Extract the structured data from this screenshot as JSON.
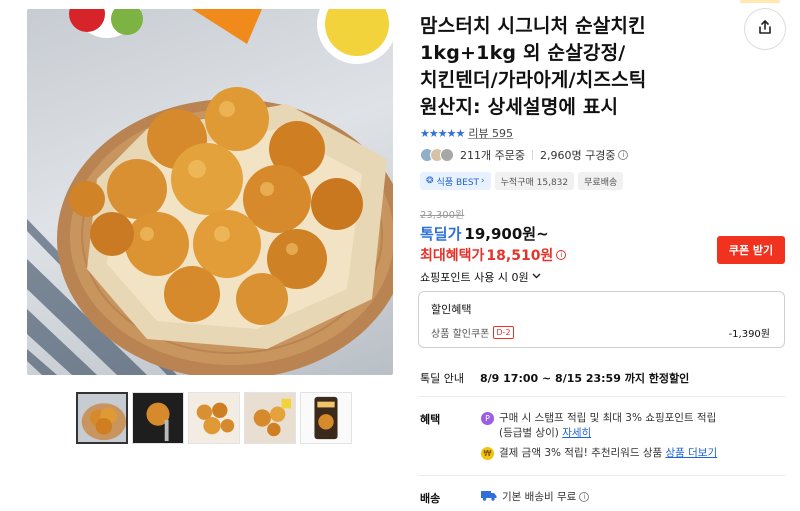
{
  "product": {
    "title": "맘스터치 시그니처 순살치킨\n1kg+1kg 외 순살강정/\n치킨텐더/가라아게/치즈스틱\n원산지: 상세설명에 표시",
    "stars": "★★★★★",
    "review_link": "리뷰 595",
    "orders_text": "211개 주문중",
    "viewers_text": "2,960명 구경중",
    "tags": [
      "식품 BEST",
      "누적구매 15,832",
      "무료배송"
    ]
  },
  "price": {
    "original": "23,300원",
    "deal_label": "톡딜가",
    "deal_price": "19,900원~",
    "max_label": "최대혜택가",
    "max_price": "18,510원",
    "coupon_button": "쿠폰 받기",
    "point_usage": "쇼핑포인트 사용 시 0원"
  },
  "discount": {
    "title": "할인혜택",
    "item_label": "상품 할인쿠폰",
    "item_badge": "D-2",
    "item_amount": "-1,390원"
  },
  "deal_info": {
    "label": "톡딜 안내",
    "text": "8/9 17:00 ~ 8/15 23:59 까지 한정할인"
  },
  "benefits": {
    "label": "혜택",
    "line1": "구매 시 스탬프 적립 및 최대 3% 쇼핑포인트 적립",
    "line1b_prefix": "(등급별 상이)",
    "line1b_link": "자세히",
    "line2_prefix": "결제 금액 3% 적립! 추천리워드 상품",
    "line2_link": "상품 더보기"
  },
  "shipping": {
    "label": "배송",
    "text": "기본 배송비 무료"
  },
  "icons": {
    "share": "share-icon",
    "chevron": "chevron-down-icon",
    "info": "info-icon",
    "truck": "truck-icon"
  },
  "colors": {
    "accent_blue": "#2f6fdb",
    "price_red": "#e6332a",
    "coupon_red": "#f0321e"
  }
}
